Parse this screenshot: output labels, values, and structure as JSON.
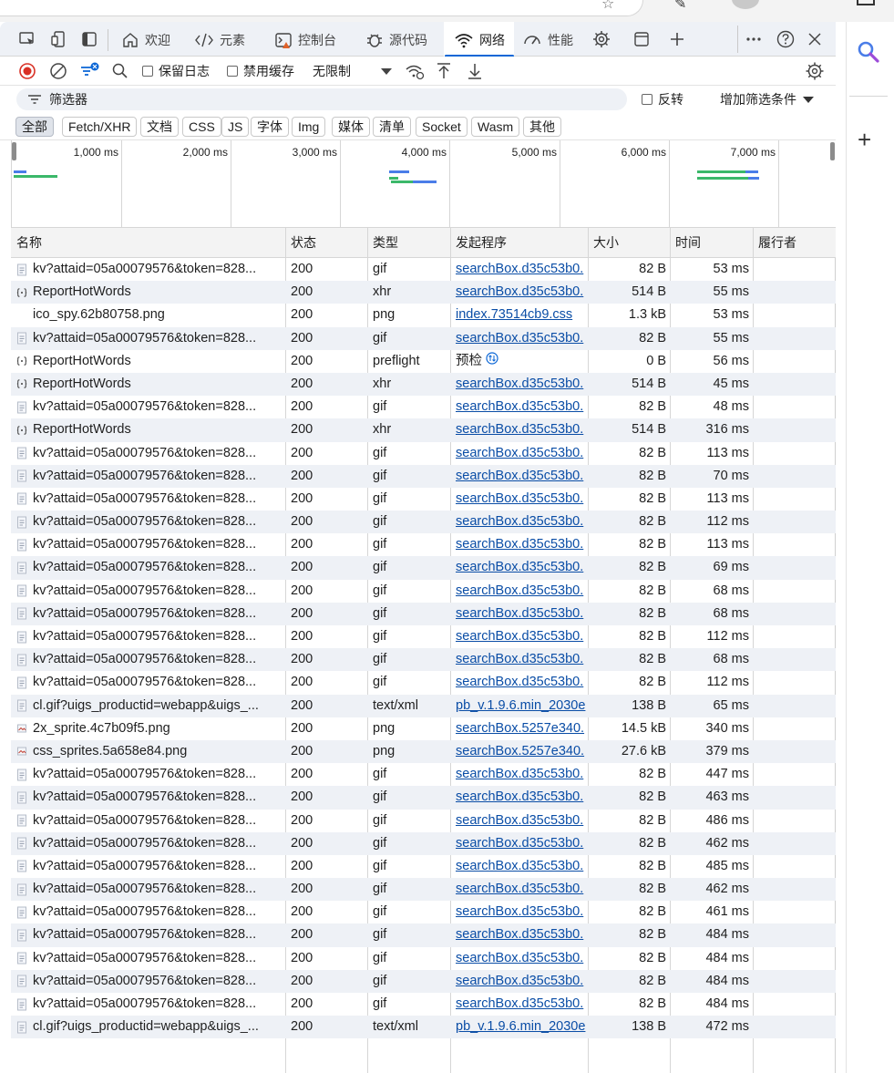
{
  "tabs": [
    {
      "label": "欢迎",
      "icon": "home-icon"
    },
    {
      "label": "元素",
      "icon": "code-icon"
    },
    {
      "label": "控制台",
      "icon": "console-icon"
    },
    {
      "label": "源代码",
      "icon": "bug-icon"
    },
    {
      "label": "网络",
      "icon": "wifi-icon",
      "active": true
    },
    {
      "label": "性能",
      "icon": "gauge-icon"
    }
  ],
  "toolbar": {
    "preserve_log": "保留日志",
    "disable_cache": "禁用缓存",
    "throttling": "无限制"
  },
  "filter": {
    "placeholder": "筛选器",
    "invert": "反转",
    "more_filters": "增加筛选条件"
  },
  "type_filters": [
    "全部",
    "Fetch/XHR",
    "文档",
    "CSS",
    "JS",
    "字体",
    "Img",
    "媒体",
    "清单",
    "Socket",
    "Wasm",
    "其他"
  ],
  "overview": {
    "ticks": [
      "1,000 ms",
      "2,000 ms",
      "3,000 ms",
      "4,000 ms",
      "5,000 ms",
      "6,000 ms",
      "7,000 ms"
    ]
  },
  "table": {
    "headers": {
      "name": "名称",
      "status": "状态",
      "type": "类型",
      "initiator": "发起程序",
      "size": "大小",
      "time": "时间",
      "fulfilled_by": "履行者"
    },
    "rows": [
      {
        "name": "kv?attaid=05a00079576&token=828...",
        "status": "200",
        "type": "gif",
        "initiator": "searchBox.d35c53b0.",
        "size": "82 B",
        "time": "53 ms",
        "icon": "file-icon"
      },
      {
        "name": "ReportHotWords",
        "status": "200",
        "type": "xhr",
        "initiator": "searchBox.d35c53b0.",
        "size": "514 B",
        "time": "55 ms",
        "icon": "xhr-icon"
      },
      {
        "name": "ico_spy.62b80758.png",
        "status": "200",
        "type": "png",
        "initiator": "index.73514cb9.css",
        "size": "1.3 kB",
        "time": "53 ms",
        "icon": "blank-icon"
      },
      {
        "name": "kv?attaid=05a00079576&token=828...",
        "status": "200",
        "type": "gif",
        "initiator": "searchBox.d35c53b0.",
        "size": "82 B",
        "time": "55 ms",
        "icon": "file-icon"
      },
      {
        "name": "ReportHotWords",
        "status": "200",
        "type": "preflight",
        "initiator": "预检",
        "initiator_plain": true,
        "size": "0 B",
        "time": "56 ms",
        "icon": "xhr-icon"
      },
      {
        "name": "ReportHotWords",
        "status": "200",
        "type": "xhr",
        "initiator": "searchBox.d35c53b0.",
        "size": "514 B",
        "time": "45 ms",
        "icon": "xhr-icon"
      },
      {
        "name": "kv?attaid=05a00079576&token=828...",
        "status": "200",
        "type": "gif",
        "initiator": "searchBox.d35c53b0.",
        "size": "82 B",
        "time": "48 ms",
        "icon": "file-icon"
      },
      {
        "name": "ReportHotWords",
        "status": "200",
        "type": "xhr",
        "initiator": "searchBox.d35c53b0.",
        "size": "514 B",
        "time": "316 ms",
        "icon": "xhr-icon"
      },
      {
        "name": "kv?attaid=05a00079576&token=828...",
        "status": "200",
        "type": "gif",
        "initiator": "searchBox.d35c53b0.",
        "size": "82 B",
        "time": "113 ms",
        "icon": "file-icon"
      },
      {
        "name": "kv?attaid=05a00079576&token=828...",
        "status": "200",
        "type": "gif",
        "initiator": "searchBox.d35c53b0.",
        "size": "82 B",
        "time": "70 ms",
        "icon": "file-icon"
      },
      {
        "name": "kv?attaid=05a00079576&token=828...",
        "status": "200",
        "type": "gif",
        "initiator": "searchBox.d35c53b0.",
        "size": "82 B",
        "time": "113 ms",
        "icon": "file-icon"
      },
      {
        "name": "kv?attaid=05a00079576&token=828...",
        "status": "200",
        "type": "gif",
        "initiator": "searchBox.d35c53b0.",
        "size": "82 B",
        "time": "112 ms",
        "icon": "file-icon"
      },
      {
        "name": "kv?attaid=05a00079576&token=828...",
        "status": "200",
        "type": "gif",
        "initiator": "searchBox.d35c53b0.",
        "size": "82 B",
        "time": "113 ms",
        "icon": "file-icon"
      },
      {
        "name": "kv?attaid=05a00079576&token=828...",
        "status": "200",
        "type": "gif",
        "initiator": "searchBox.d35c53b0.",
        "size": "82 B",
        "time": "69 ms",
        "icon": "file-icon"
      },
      {
        "name": "kv?attaid=05a00079576&token=828...",
        "status": "200",
        "type": "gif",
        "initiator": "searchBox.d35c53b0.",
        "size": "82 B",
        "time": "68 ms",
        "icon": "file-icon"
      },
      {
        "name": "kv?attaid=05a00079576&token=828...",
        "status": "200",
        "type": "gif",
        "initiator": "searchBox.d35c53b0.",
        "size": "82 B",
        "time": "68 ms",
        "icon": "file-icon"
      },
      {
        "name": "kv?attaid=05a00079576&token=828...",
        "status": "200",
        "type": "gif",
        "initiator": "searchBox.d35c53b0.",
        "size": "82 B",
        "time": "112 ms",
        "icon": "file-icon"
      },
      {
        "name": "kv?attaid=05a00079576&token=828...",
        "status": "200",
        "type": "gif",
        "initiator": "searchBox.d35c53b0.",
        "size": "82 B",
        "time": "68 ms",
        "icon": "file-icon"
      },
      {
        "name": "kv?attaid=05a00079576&token=828...",
        "status": "200",
        "type": "gif",
        "initiator": "searchBox.d35c53b0.",
        "size": "82 B",
        "time": "112 ms",
        "icon": "file-icon"
      },
      {
        "name": "cl.gif?uigs_productid=webapp&uigs_...",
        "status": "200",
        "type": "text/xml",
        "initiator": "pb_v.1.9.6.min_2030e",
        "size": "138 B",
        "time": "65 ms",
        "icon": "file-icon"
      },
      {
        "name": "2x_sprite.4c7b09f5.png",
        "status": "200",
        "type": "png",
        "initiator": "searchBox.5257e340.",
        "size": "14.5 kB",
        "time": "340 ms",
        "icon": "image-icon"
      },
      {
        "name": "css_sprites.5a658e84.png",
        "status": "200",
        "type": "png",
        "initiator": "searchBox.5257e340.",
        "size": "27.6 kB",
        "time": "379 ms",
        "icon": "image-icon"
      },
      {
        "name": "kv?attaid=05a00079576&token=828...",
        "status": "200",
        "type": "gif",
        "initiator": "searchBox.d35c53b0.",
        "size": "82 B",
        "time": "447 ms",
        "icon": "file-icon"
      },
      {
        "name": "kv?attaid=05a00079576&token=828...",
        "status": "200",
        "type": "gif",
        "initiator": "searchBox.d35c53b0.",
        "size": "82 B",
        "time": "463 ms",
        "icon": "file-icon"
      },
      {
        "name": "kv?attaid=05a00079576&token=828...",
        "status": "200",
        "type": "gif",
        "initiator": "searchBox.d35c53b0.",
        "size": "82 B",
        "time": "486 ms",
        "icon": "file-icon"
      },
      {
        "name": "kv?attaid=05a00079576&token=828...",
        "status": "200",
        "type": "gif",
        "initiator": "searchBox.d35c53b0.",
        "size": "82 B",
        "time": "462 ms",
        "icon": "file-icon"
      },
      {
        "name": "kv?attaid=05a00079576&token=828...",
        "status": "200",
        "type": "gif",
        "initiator": "searchBox.d35c53b0.",
        "size": "82 B",
        "time": "485 ms",
        "icon": "file-icon"
      },
      {
        "name": "kv?attaid=05a00079576&token=828...",
        "status": "200",
        "type": "gif",
        "initiator": "searchBox.d35c53b0.",
        "size": "82 B",
        "time": "462 ms",
        "icon": "file-icon"
      },
      {
        "name": "kv?attaid=05a00079576&token=828...",
        "status": "200",
        "type": "gif",
        "initiator": "searchBox.d35c53b0.",
        "size": "82 B",
        "time": "461 ms",
        "icon": "file-icon"
      },
      {
        "name": "kv?attaid=05a00079576&token=828...",
        "status": "200",
        "type": "gif",
        "initiator": "searchBox.d35c53b0.",
        "size": "82 B",
        "time": "484 ms",
        "icon": "file-icon"
      },
      {
        "name": "kv?attaid=05a00079576&token=828...",
        "status": "200",
        "type": "gif",
        "initiator": "searchBox.d35c53b0.",
        "size": "82 B",
        "time": "484 ms",
        "icon": "file-icon"
      },
      {
        "name": "kv?attaid=05a00079576&token=828...",
        "status": "200",
        "type": "gif",
        "initiator": "searchBox.d35c53b0.",
        "size": "82 B",
        "time": "484 ms",
        "icon": "file-icon"
      },
      {
        "name": "kv?attaid=05a00079576&token=828...",
        "status": "200",
        "type": "gif",
        "initiator": "searchBox.d35c53b0.",
        "size": "82 B",
        "time": "484 ms",
        "icon": "file-icon"
      },
      {
        "name": "cl.gif?uigs_productid=webapp&uigs_...",
        "status": "200",
        "type": "text/xml",
        "initiator": "pb_v.1.9.6.min_2030e",
        "size": "138 B",
        "time": "472 ms",
        "icon": "file-icon"
      }
    ]
  },
  "colors": {
    "accent": "#0a66d6",
    "record_red": "#d93025",
    "link": "#0a4da6",
    "row_alt": "#eef1f6"
  }
}
